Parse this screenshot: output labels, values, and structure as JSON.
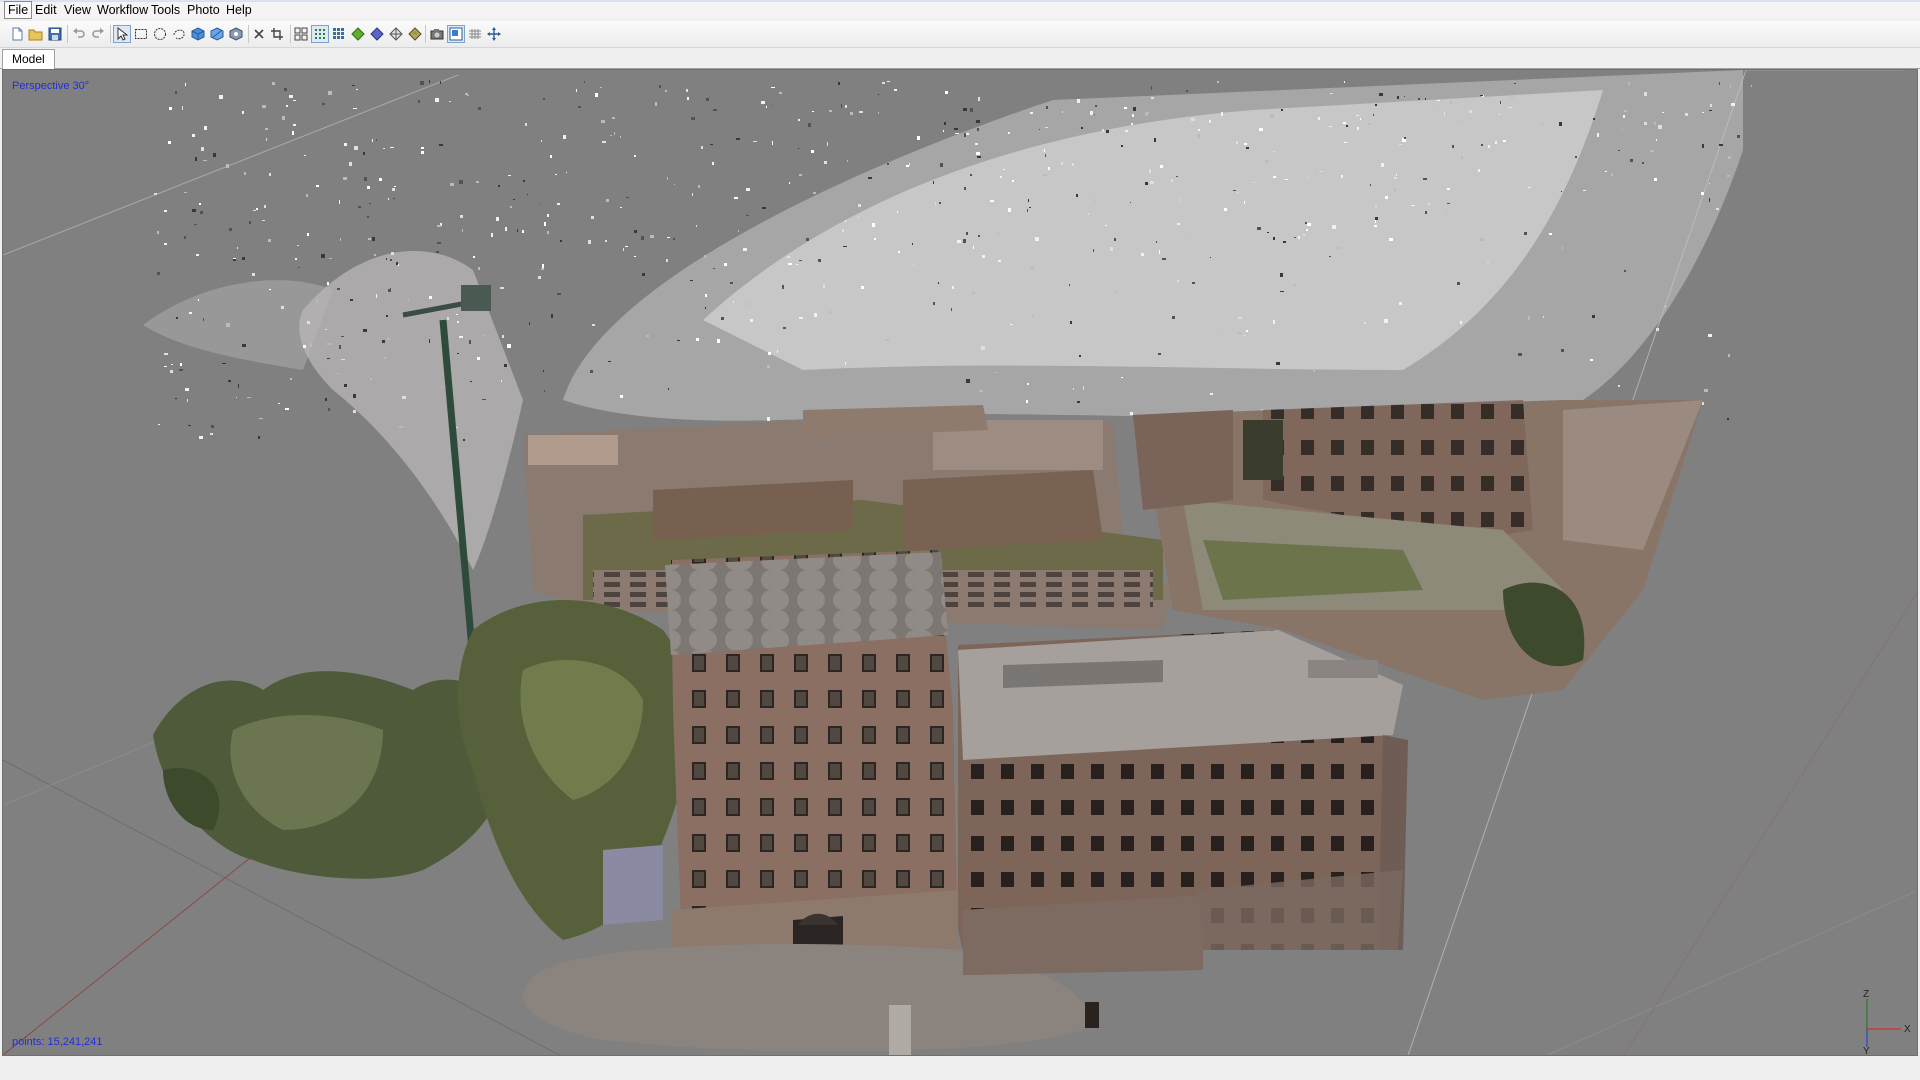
{
  "menu": [
    "File",
    "Edit",
    "View",
    "Workflow",
    "Tools",
    "Photo",
    "Help"
  ],
  "toolbar": {
    "icons": [
      {
        "name": "new-document-icon"
      },
      {
        "name": "open-folder-icon"
      },
      {
        "name": "save-icon"
      },
      {
        "name": "undo-icon"
      },
      {
        "name": "redo-icon"
      },
      {
        "name": "navigation-arrow-icon",
        "pressed": true
      },
      {
        "name": "rectangle-selection-icon"
      },
      {
        "name": "circle-selection-icon"
      },
      {
        "name": "free-form-selection-icon"
      },
      {
        "name": "rotate-object-icon"
      },
      {
        "name": "move-region-icon"
      },
      {
        "name": "resize-region-icon"
      },
      {
        "name": "delete-selection-icon"
      },
      {
        "name": "crop-selection-icon"
      },
      {
        "name": "show-cameras-icon"
      },
      {
        "name": "point-cloud-view-icon",
        "pressed": true
      },
      {
        "name": "dense-cloud-view-icon"
      },
      {
        "name": "shaded-model-icon"
      },
      {
        "name": "solid-model-icon"
      },
      {
        "name": "wireframe-model-icon"
      },
      {
        "name": "textured-model-icon"
      },
      {
        "name": "camera-icon"
      },
      {
        "name": "show-region-icon",
        "pressed": true
      },
      {
        "name": "show-grid-icon"
      },
      {
        "name": "reset-view-icon"
      }
    ]
  },
  "tabs": [
    "Model"
  ],
  "viewport": {
    "projection_label": "Perspective 30°",
    "points_label": "points: 15,241,241",
    "axis_labels": {
      "x": "X",
      "y": "Y",
      "z": "Z"
    },
    "background_color": "#808080",
    "overlay_text_color": "#1f2fd8"
  }
}
